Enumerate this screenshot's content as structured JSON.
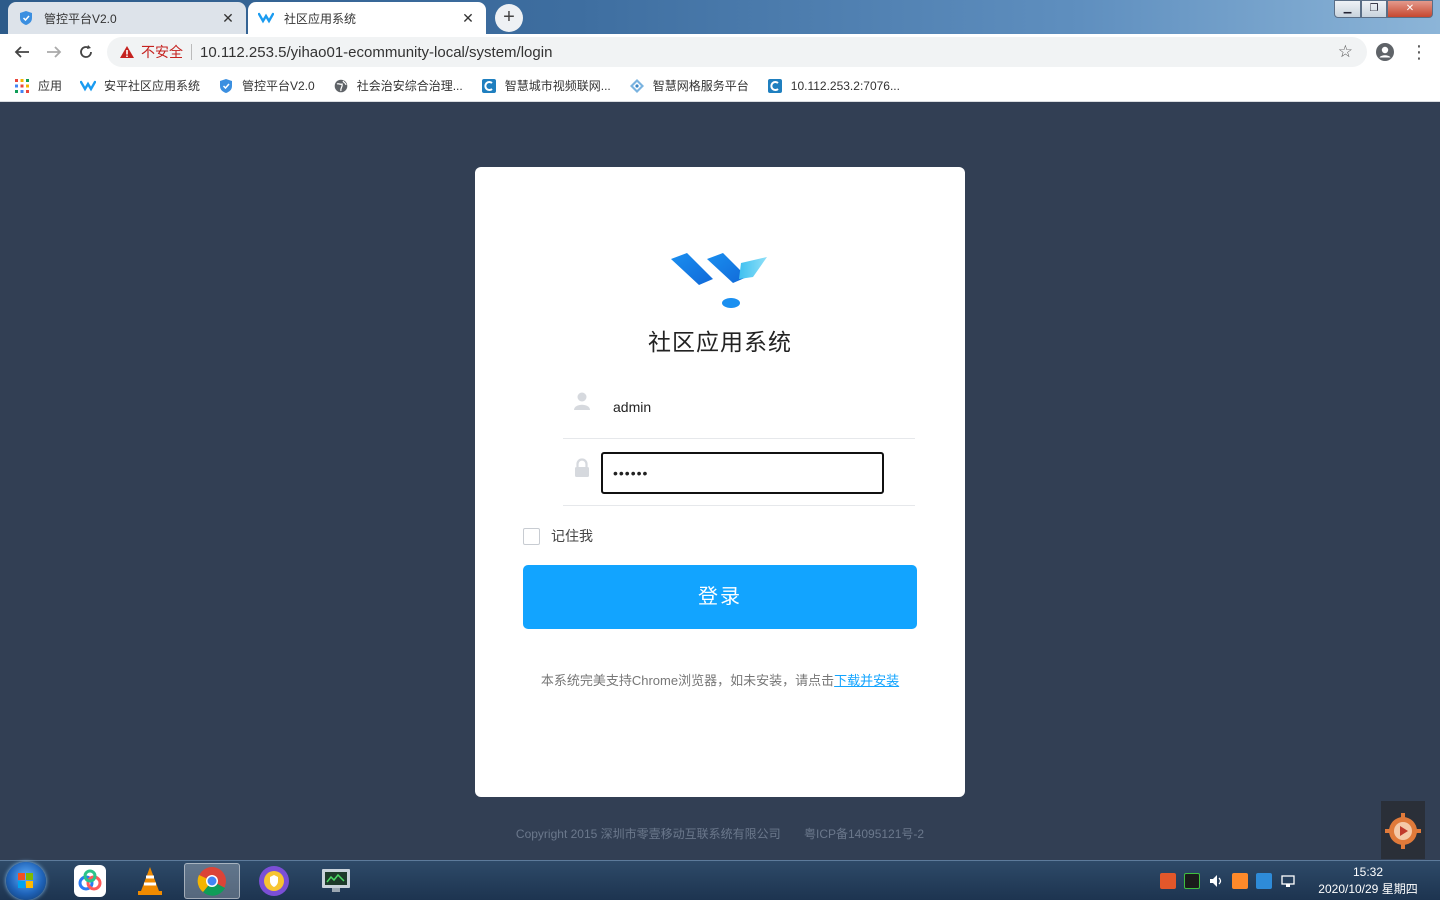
{
  "browser": {
    "tabs": [
      {
        "title": "管控平台V2.0",
        "favicon": "shield-icon",
        "active": false
      },
      {
        "title": "社区应用系统",
        "favicon": "w-logo-icon",
        "active": true
      }
    ],
    "new_tab": "+",
    "address": {
      "security_label": "不安全",
      "url": "10.112.253.5/yihao01-ecommunity-local/system/login"
    },
    "bookmarks": [
      {
        "label": "应用",
        "icon": "apps-grid-icon"
      },
      {
        "label": "安平社区应用系统",
        "icon": "w-logo-icon"
      },
      {
        "label": "管控平台V2.0",
        "icon": "shield-icon"
      },
      {
        "label": "社会治安综合治理...",
        "icon": "globe-icon"
      },
      {
        "label": "智慧城市视频联网...",
        "icon": "c-app-icon"
      },
      {
        "label": "智慧网格服务平台",
        "icon": "grid-service-icon"
      },
      {
        "label": "10.112.253.2:7076...",
        "icon": "c-app-icon"
      }
    ]
  },
  "login": {
    "system_title": "社区应用系统",
    "username": "admin",
    "password_mask": "••••••",
    "remember_label": "记住我",
    "login_button": "登录",
    "hint_prefix": "本系统完美支持Chrome浏览器，如未安装，请点击",
    "hint_link": "下载并安装"
  },
  "footer": {
    "copyright": "Copyright 2015 深圳市零壹移动互联系统有限公司",
    "icp": "粤ICP备14095121号-2"
  },
  "taskbar": {
    "clock_time": "15:32",
    "clock_date": "2020/10/29 星期四"
  },
  "colors": {
    "page_bg": "#323f54",
    "primary": "#12a4ff",
    "warning": "#c5221f"
  }
}
